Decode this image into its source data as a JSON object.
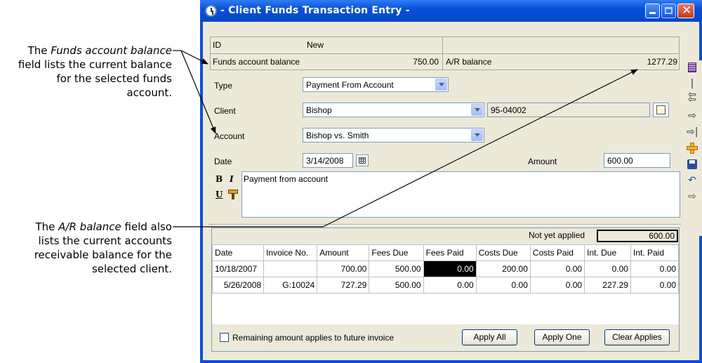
{
  "callouts": {
    "funds": {
      "pre": "The ",
      "em": "Funds account balance",
      "post": " field lists the current balance for the selected funds account."
    },
    "ar": {
      "pre": "The ",
      "em": "A/R balance",
      "post": " field also lists the current accounts receivable balance for the selected client."
    }
  },
  "window": {
    "title": " - Client Funds Transaction Entry -"
  },
  "header": {
    "id_label": "ID",
    "id_value": "New",
    "funds_balance_label": "Funds account balance",
    "funds_balance_value": "750.00",
    "ar_balance_label": "A/R balance",
    "ar_balance_value": "1277.29"
  },
  "form": {
    "type_label": "Type",
    "type_value": "Payment From Account",
    "client_label": "Client",
    "client_value": "Bishop",
    "client_code": "95-04002",
    "account_label": "Account",
    "account_value": "Bishop vs. Smith",
    "date_label": "Date",
    "date_value": "3/14/2008",
    "amount_label": "Amount",
    "amount_value": "600.00",
    "memo_text": "Payment from account",
    "format_bold": "B",
    "format_italic": "I",
    "format_underline": "U"
  },
  "applies": {
    "not_yet_applied_label": "Not yet applied",
    "not_yet_applied_value": "600.00",
    "columns": [
      "Date",
      "Invoice No.",
      "Amount",
      "Fees Due",
      "Fees Paid",
      "Costs Due",
      "Costs Paid",
      "Int. Due",
      "Int. Paid"
    ],
    "rows": [
      [
        "10/18/2007",
        "",
        "700.00",
        "500.00",
        "0.00",
        "200.00",
        "0.00",
        "0.00",
        "0.00"
      ],
      [
        "5/26/2008",
        "G:10024",
        "727.29",
        "500.00",
        "0.00",
        "0.00",
        "0.00",
        "227.29",
        "0.00"
      ]
    ]
  },
  "footer": {
    "remaining_label": "Remaining amount applies to future invoice",
    "apply_all": "Apply All",
    "apply_one": "Apply One",
    "clear_applies": "Clear Applies"
  },
  "toolbar_icons": [
    "list-icon",
    "first-record-icon",
    "previous-icon",
    "next-icon",
    "last-record-icon",
    "add-icon",
    "save-icon",
    "undo-icon",
    "exit-icon"
  ]
}
